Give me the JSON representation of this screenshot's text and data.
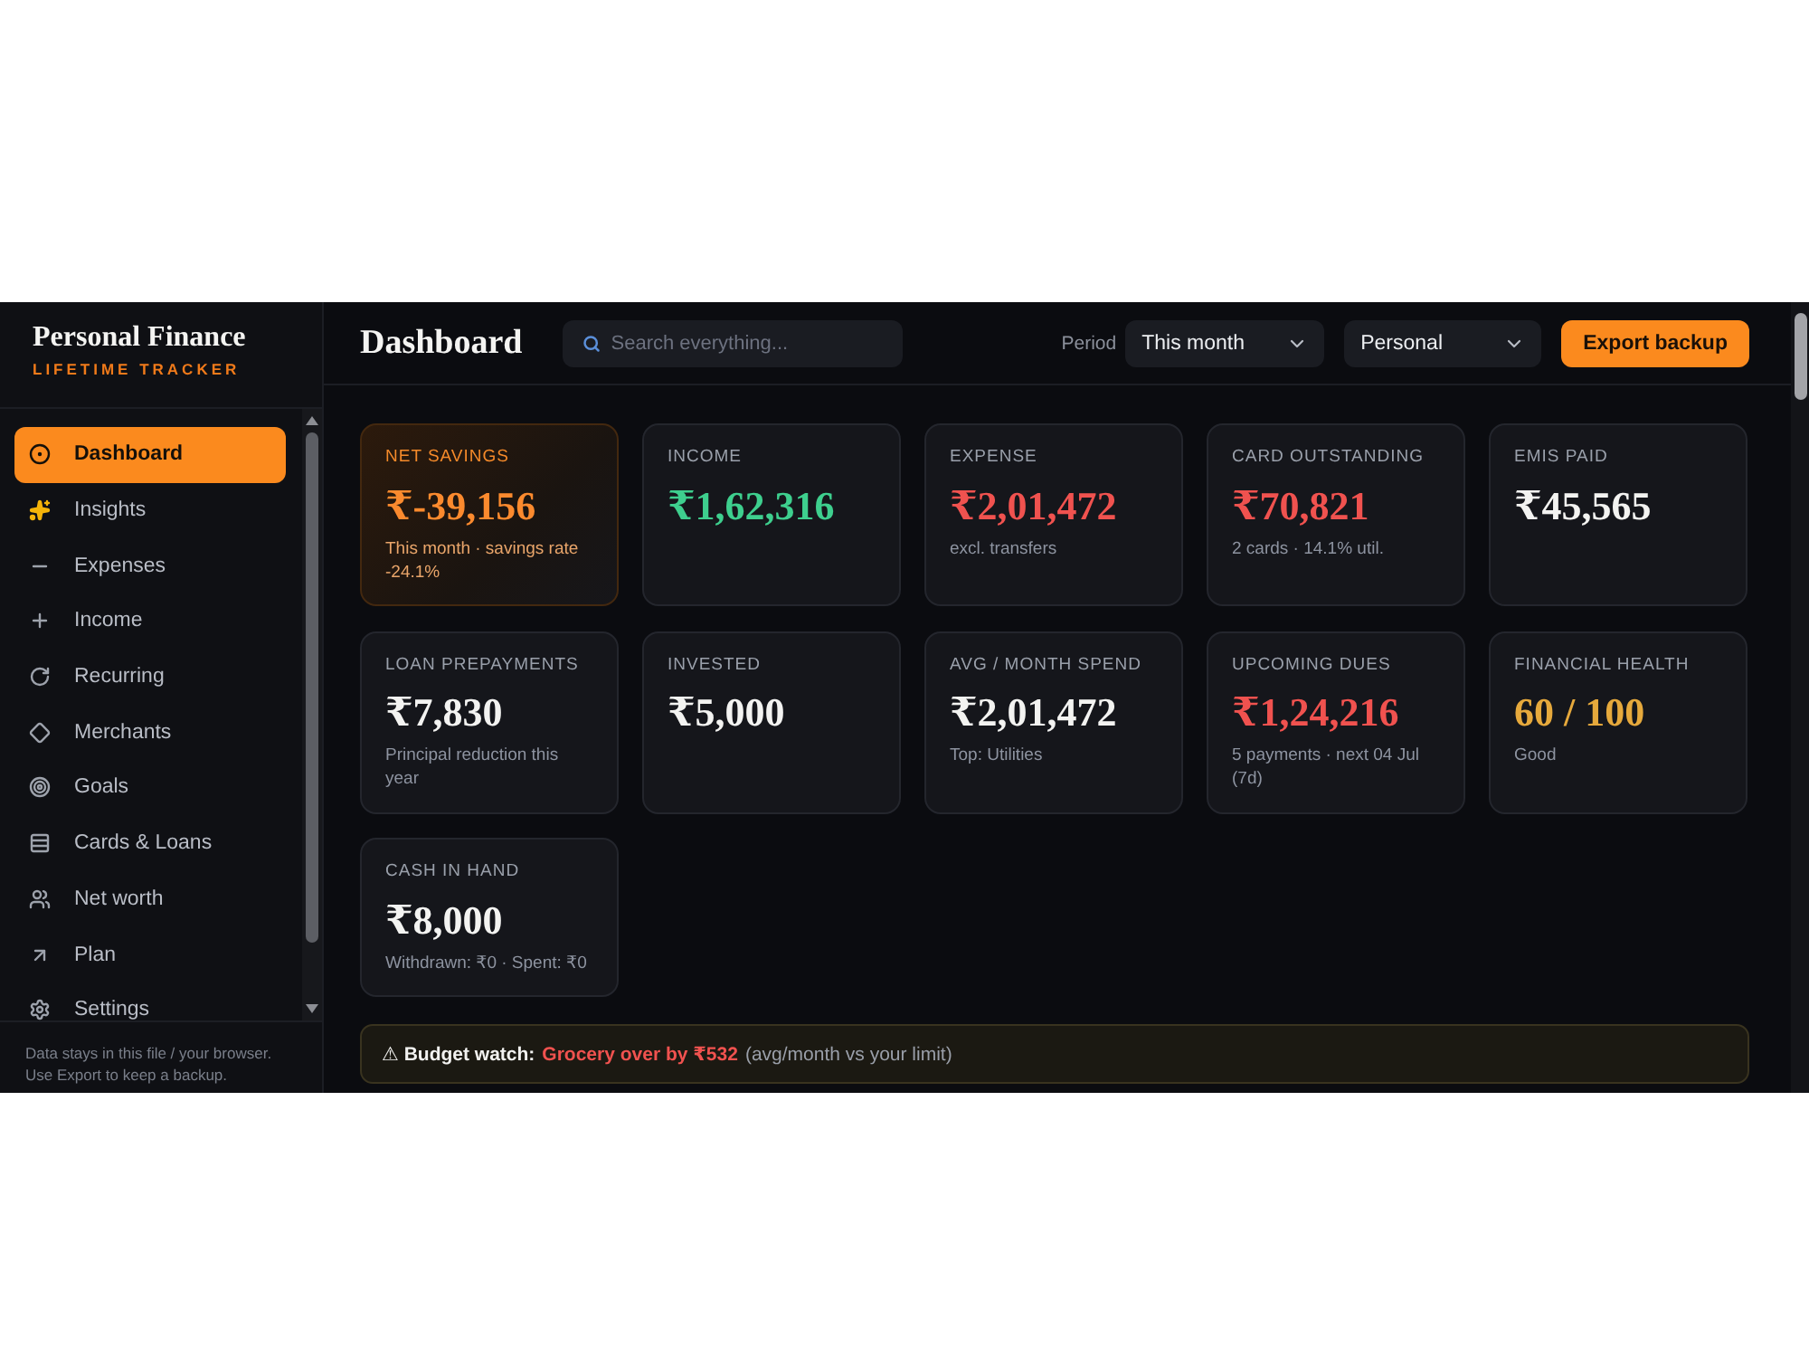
{
  "sidebar": {
    "brand": {
      "title": "Personal Finance",
      "subtitle": "LIFETIME TRACKER"
    },
    "nav": [
      {
        "label": "Dashboard",
        "selected": true
      },
      {
        "label": "Insights",
        "selected": false
      },
      {
        "label": "Expenses",
        "selected": false
      },
      {
        "label": "Income",
        "selected": false
      },
      {
        "label": "Recurring",
        "selected": false
      },
      {
        "label": "Merchants",
        "selected": false
      },
      {
        "label": "Goals",
        "selected": false
      },
      {
        "label": "Cards & Loans",
        "selected": false
      },
      {
        "label": "Net worth",
        "selected": false
      },
      {
        "label": "Plan",
        "selected": false
      },
      {
        "label": "Settings",
        "selected": false
      }
    ],
    "footer_lines": [
      "Data stays in this file / your browser.",
      "Use Export to keep a backup."
    ]
  },
  "header": {
    "title": "Dashboard",
    "search": {
      "placeholder": "Search everything..."
    },
    "period": {
      "label": "Period",
      "value": "This month"
    },
    "profile": {
      "value": "Personal"
    },
    "export_button": "Export backup"
  },
  "cards": [
    {
      "kind": "highlight",
      "label": "NET SAVINGS",
      "value": "₹-39,156",
      "note": "This month · savings rate -24.1%"
    },
    {
      "kind": "positive",
      "label": "INCOME",
      "value": "₹1,62,316"
    },
    {
      "kind": "negative",
      "label": "EXPENSE",
      "value": "₹2,01,472",
      "note": "excl. transfers"
    },
    {
      "kind": "negative",
      "label": "CARD OUTSTANDING",
      "value": "₹70,821",
      "note": "2 cards · 14.1% util."
    },
    {
      "kind": "plain",
      "label": "EMIS PAID",
      "value": "₹45,565"
    },
    {
      "kind": "plain",
      "label": "LOAN PREPAYMENTS",
      "value": "₹7,830",
      "note": "Principal reduction this year"
    },
    {
      "kind": "plain",
      "label": "INVESTED",
      "value": "₹5,000"
    },
    {
      "kind": "plain",
      "label": "AVG / MONTH SPEND",
      "value": "₹2,01,472",
      "note": "Top: Utilities"
    },
    {
      "kind": "negative",
      "label": "UPCOMING DUES",
      "value": "₹1,24,216",
      "note": "5 payments · next 04 Jul (7d)"
    },
    {
      "kind": "warning",
      "label": "FINANCIAL HEALTH",
      "value": "60 / 100",
      "note": "Good"
    },
    {
      "kind": "plain",
      "label": "CASH IN HAND",
      "value": "₹8,000",
      "note": "Withdrawn: ₹0 · Spent: ₹0"
    }
  ],
  "budget_watch": {
    "label": "⚠ Budget watch:",
    "alert": "Grocery over by ₹532",
    "note": "(avg/month vs your limit)"
  }
}
